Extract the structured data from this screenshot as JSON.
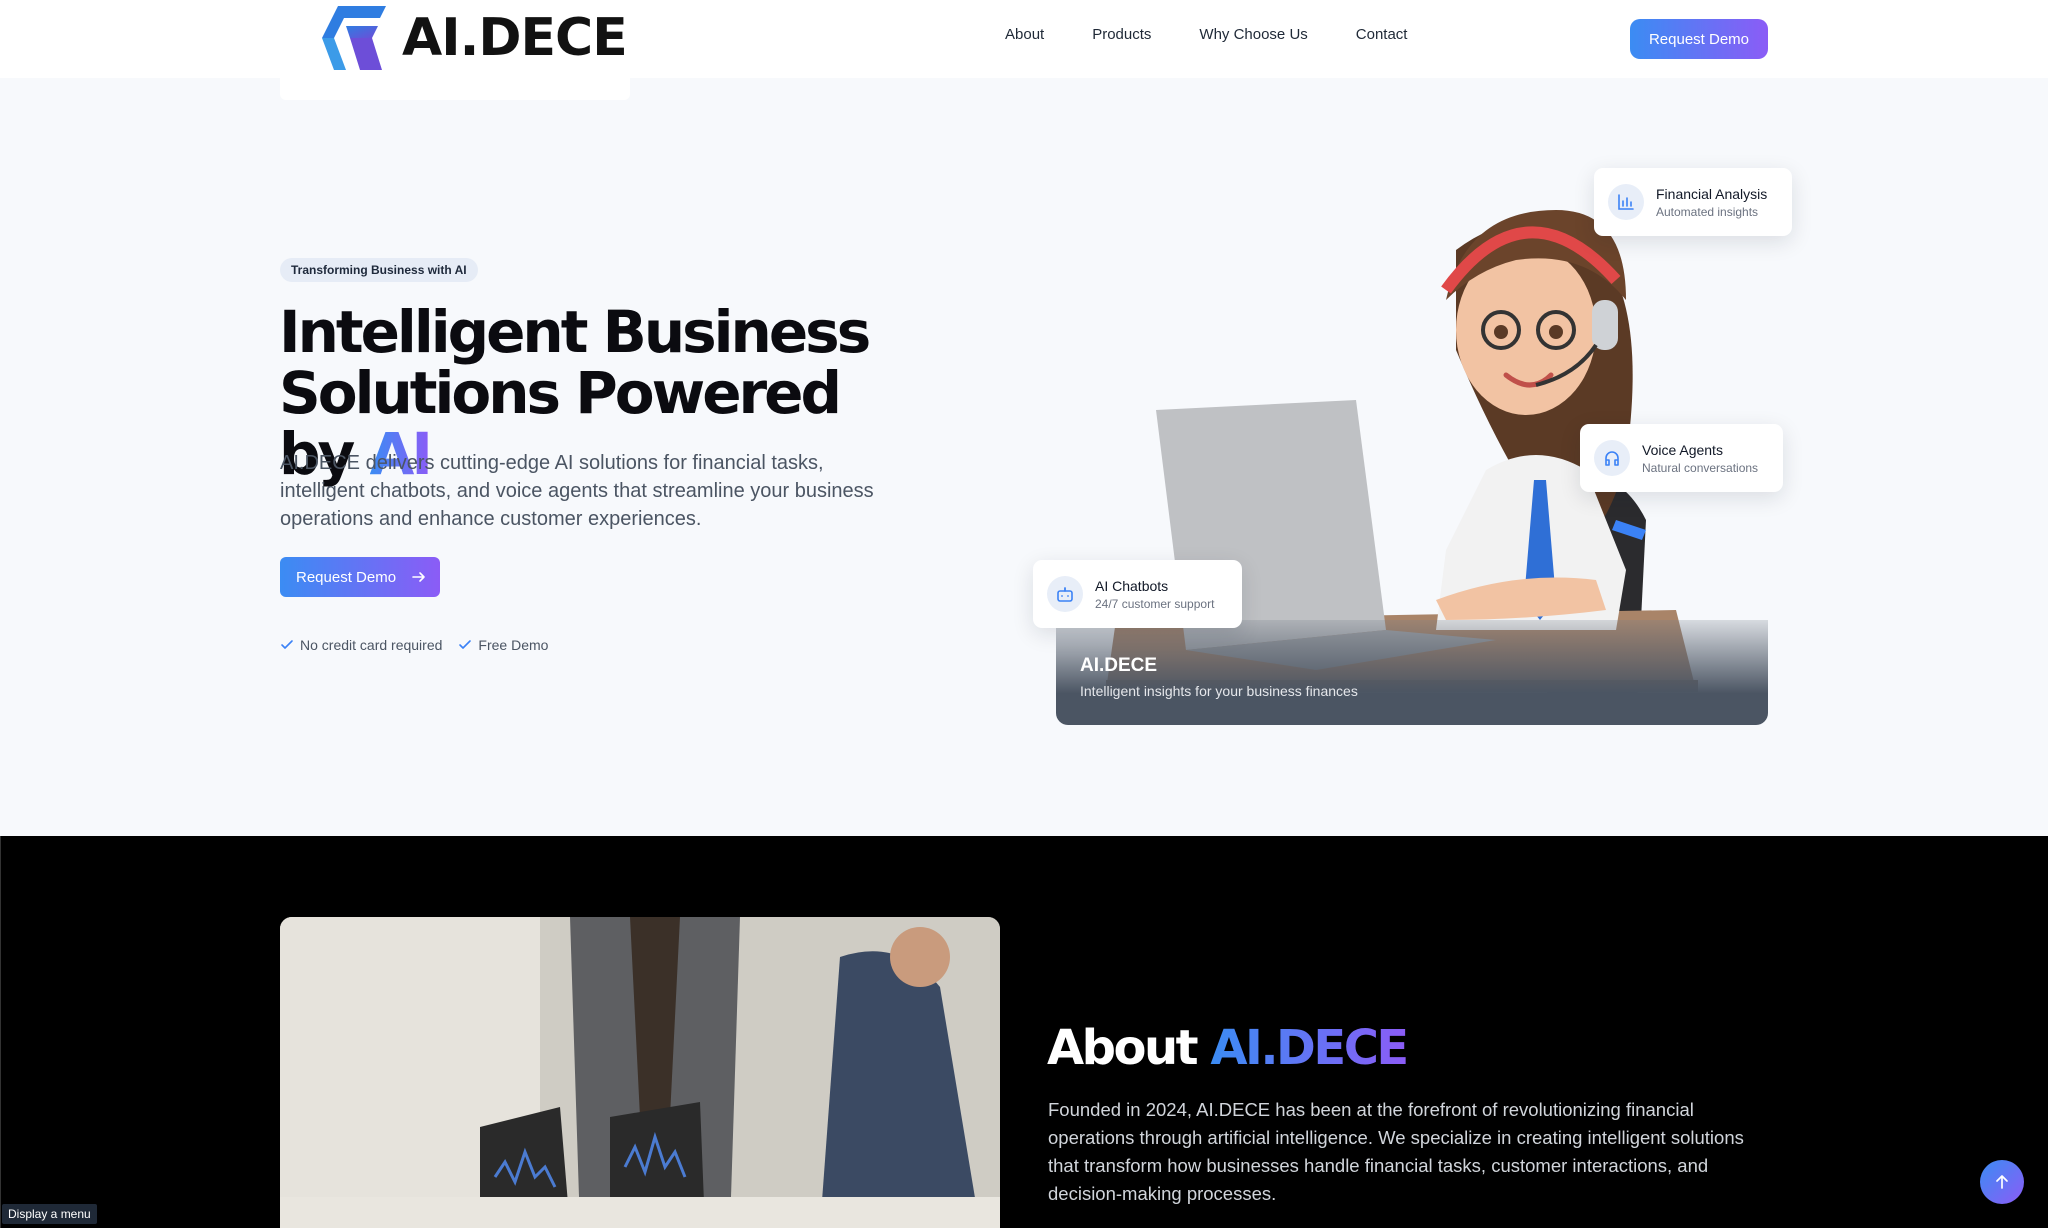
{
  "brand": {
    "name": "AI.DECE"
  },
  "nav": {
    "links": [
      "About",
      "Products",
      "Why Choose Us",
      "Contact"
    ],
    "cta": "Request Demo"
  },
  "hero": {
    "badge": "Transforming Business with AI",
    "title_line1": "Intelligent Business",
    "title_line2": "Solutions Powered by ",
    "title_accent": "AI",
    "description": "AI.DECE delivers cutting-edge AI solutions for financial tasks, intelligent chatbots, and voice agents that streamline your business operations and enhance customer experiences.",
    "cta": "Request Demo",
    "checks": [
      "No credit card required",
      "Free Demo"
    ]
  },
  "illustration": {
    "caption_title": "AI.DECE",
    "caption_sub": "Intelligent insights for your business finances"
  },
  "features": [
    {
      "title": "Financial Analysis",
      "subtitle": "Automated insights",
      "icon": "bar-chart-icon"
    },
    {
      "title": "Voice Agents",
      "subtitle": "Natural conversations",
      "icon": "headphones-icon"
    },
    {
      "title": "AI Chatbots",
      "subtitle": "24/7 customer support",
      "icon": "bot-icon"
    }
  ],
  "about": {
    "title": "About ",
    "title_accent": "AI.DECE",
    "description": "Founded in 2024, AI.DECE has been at the forefront of revolutionizing financial operations through artificial intelligence. We specialize in creating intelligent solutions that transform how businesses handle financial tasks, customer interactions, and decision-making processes."
  },
  "tooltip": "Display a menu",
  "colors": {
    "accent_start": "#3b8cf3",
    "accent_end": "#8b5cf6"
  }
}
